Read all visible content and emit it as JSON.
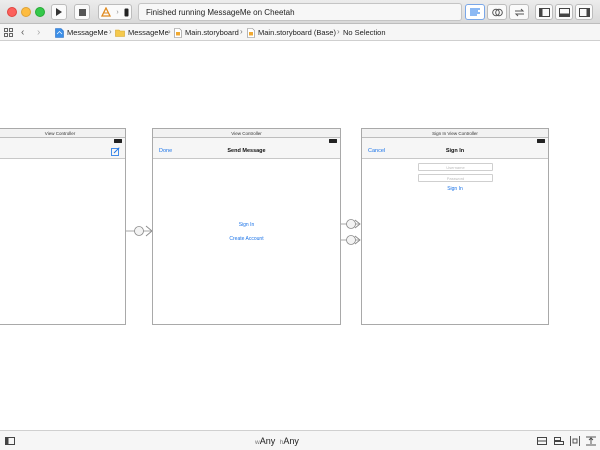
{
  "toolbar": {
    "status_text": "Finished running MessageMe on Cheetah",
    "accent": "#1a73e8"
  },
  "breadcrumb": {
    "items": [
      {
        "label": "MessageMe",
        "icon": "project-icon"
      },
      {
        "label": "MessageMe",
        "icon": "folder-icon"
      },
      {
        "label": "Main.storyboard",
        "icon": "storyboard-icon"
      },
      {
        "label": "Main.storyboard (Base)",
        "icon": "storyboard-icon"
      },
      {
        "label": "No Selection"
      }
    ]
  },
  "scenes": {
    "vc1": {
      "title": "View Controller"
    },
    "vc2": {
      "title": "View Controller",
      "nav_title": "Send Message",
      "nav_left": "Done",
      "links": [
        "Sign In",
        "Create Account"
      ]
    },
    "vc3": {
      "title": "Sign In View Controller",
      "nav_title": "Sign In",
      "nav_left": "Cancel",
      "fields": [
        "Username",
        "Password"
      ],
      "link": "Sign In"
    }
  },
  "bottom": {
    "size_w_prefix": "w",
    "size_w": "Any",
    "size_h_prefix": "h",
    "size_h": "Any"
  }
}
